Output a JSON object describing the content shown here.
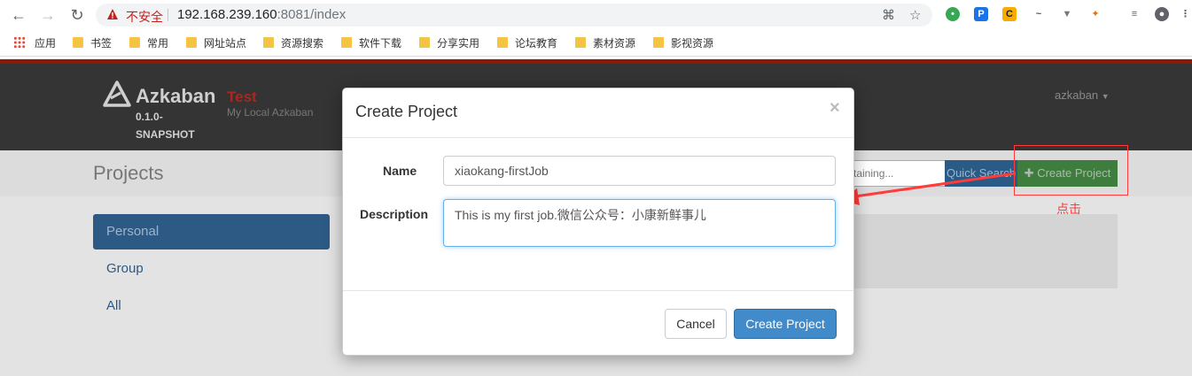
{
  "browser": {
    "security_label": "不安全",
    "url_host": "192.168.239.160",
    "url_rest": ":8081/index",
    "icons": [
      "back-icon",
      "forward-icon",
      "reload-icon",
      "translate-icon",
      "star-icon",
      "profile-icon",
      "menu-icon"
    ]
  },
  "bookmarks": {
    "apps_label": "应用",
    "items": [
      "书签",
      "常用",
      "网址站点",
      "资源搜索",
      "软件下载",
      "分享实用",
      "论坛教育",
      "素材资源",
      "影视资源"
    ]
  },
  "header": {
    "brand": "Azkaban",
    "version_line1": "0.1.0-",
    "version_line2": "SNAPSHOT",
    "env_name": "Test",
    "env_desc": "My Local Azkaban",
    "user": "azkaban"
  },
  "subheader": {
    "title": "Projects",
    "search_placeholder": "taining...",
    "quick_search_label": "Quick Search",
    "create_label": "Create Project"
  },
  "sidebar": {
    "items": [
      {
        "label": "Personal",
        "active": true
      },
      {
        "label": "Group",
        "active": false
      },
      {
        "label": "All",
        "active": false
      }
    ]
  },
  "annotation": {
    "label": "点击",
    "color": "#ff3b3b"
  },
  "modal": {
    "title": "Create Project",
    "close_glyph": "×",
    "name_label": "Name",
    "name_value": "xiaokang-firstJob",
    "description_label": "Description",
    "description_value": "This is my first job.微信公众号：小康新鲜事儿",
    "cancel_label": "Cancel",
    "submit_label": "Create Project"
  },
  "colors": {
    "navbar": "#343434",
    "accent_red": "#8b1a0a",
    "primary": "#428bca",
    "success": "#3e7d3e"
  }
}
